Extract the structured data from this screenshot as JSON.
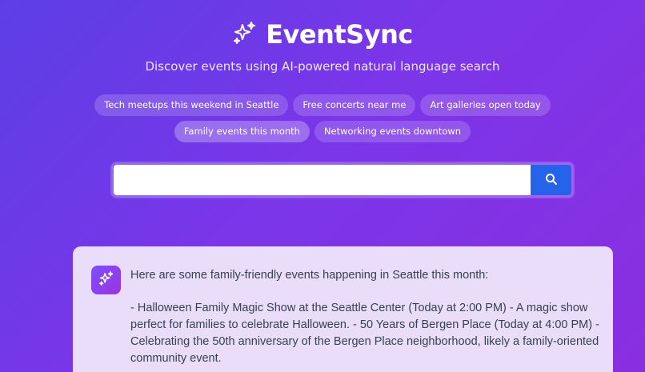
{
  "brand": {
    "title": "EventSync",
    "subtitle": "Discover events using AI-powered natural language search",
    "icon": "sparkles-icon"
  },
  "suggestions": {
    "row1": [
      "Tech meetups this weekend in Seattle",
      "Free concerts near me",
      "Art galleries open today"
    ],
    "row2": [
      "Family events this month",
      "Networking events downtown"
    ],
    "active": "Family events this month"
  },
  "search": {
    "value": "",
    "placeholder": "",
    "button_icon": "search-icon",
    "button_color": "#2563eb"
  },
  "result": {
    "avatar_icon": "sparkles-icon",
    "intro": "Here are some family-friendly events happening in Seattle this month:",
    "body": "- Halloween Family Magic Show at the Seattle Center (Today at 2:00 PM) - A magic show perfect for families to celebrate Halloween. - 50 Years of Bergen Place (Today at 4:00 PM) - Celebrating the 50th anniversary of the Bergen Place neighborhood, likely a family-oriented community event."
  },
  "colors": {
    "background_start": "#5b3fe6",
    "background_end": "#8a2fe0",
    "card_background": "#e9ddfa",
    "accent": "#2563eb"
  }
}
